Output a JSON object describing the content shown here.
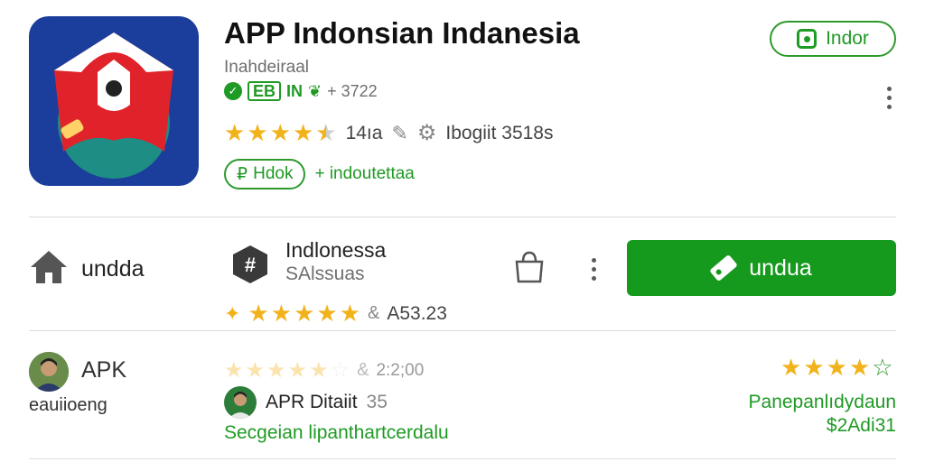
{
  "header": {
    "title": "APP Indonsian Indanesia",
    "subtitle": "Inahdeiraal",
    "badge_text": "EB",
    "badge_text_2": "IN",
    "badge_count": "+ 3722",
    "rating_count": "14ıa",
    "download_count": "Ibogiit 3518s",
    "tag_pill": "Hdok",
    "tag_text": "+ indoutettaa",
    "top_button": "Indor",
    "rating": 4.5
  },
  "row2": {
    "home_label": "undda",
    "app_title": "Indlonessa",
    "app_subtitle": "SAlssuas",
    "rating_value": "A53.23",
    "download_button": "undua",
    "rating": 5
  },
  "row3": {
    "user_label": "APK",
    "user_sub": "eauiioeng",
    "rating_count": "2:2;00",
    "detail_label": "APR Ditaiit",
    "detail_count": "35",
    "link_text": "Secgeian lipanthartcerdalu",
    "right_label": "Panepanlıdydaun",
    "price": "$2Adi31",
    "faded_rating": 5,
    "right_rating": 4
  },
  "colors": {
    "accent_green": "#1f9a24",
    "button_green": "#169a1e",
    "star_gold": "#f2b21b",
    "icon_blue": "#1b3d9c",
    "icon_red": "#e0232a"
  }
}
